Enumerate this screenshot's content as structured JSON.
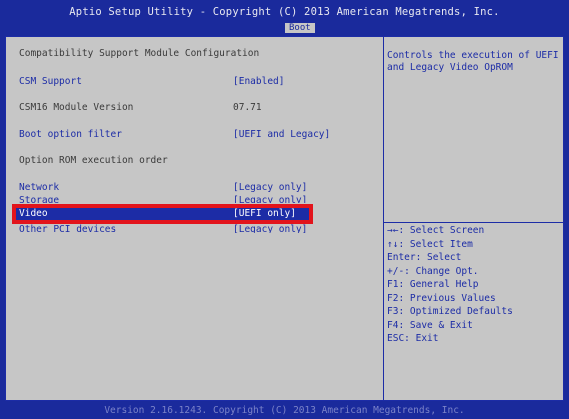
{
  "header": {
    "title": "Aptio Setup Utility - Copyright (C) 2013 American Megatrends, Inc.",
    "active_tab": "Boot"
  },
  "main": {
    "section_title": "Compatibility Support Module Configuration",
    "csm_support": {
      "label": "CSM Support",
      "value": "[Enabled]"
    },
    "csm16_version": {
      "label": "CSM16 Module Version",
      "value": "07.71"
    },
    "boot_option_filter": {
      "label": "Boot option filter",
      "value": "[UEFI and Legacy]"
    },
    "rom_order_heading": "Option ROM execution order",
    "network": {
      "label": "Network",
      "value": "[Legacy only]"
    },
    "storage": {
      "label": "Storage",
      "value": "[Legacy only]"
    },
    "video": {
      "label": "Video",
      "value": "[UEFI only]"
    },
    "other_pci": {
      "label": "Other PCI devices",
      "value": "[Legacy only]"
    }
  },
  "help": {
    "text": "Controls the execution of UEFI and Legacy Video OpROM"
  },
  "keys": [
    "→←: Select Screen",
    "↑↓: Select Item",
    "Enter: Select",
    "+/-: Change Opt.",
    "F1: General Help",
    "F2: Previous Values",
    "F3: Optimized Defaults",
    "F4: Save & Exit",
    "ESC: Exit"
  ],
  "footer": {
    "text": "Version 2.16.1243. Copyright (C) 2013 American Megatrends, Inc."
  },
  "colors": {
    "background": "#1a2a9c",
    "panel": "#c6c6c6",
    "highlight_box": "#e2141c",
    "selected_row": "#1c2ca6"
  }
}
